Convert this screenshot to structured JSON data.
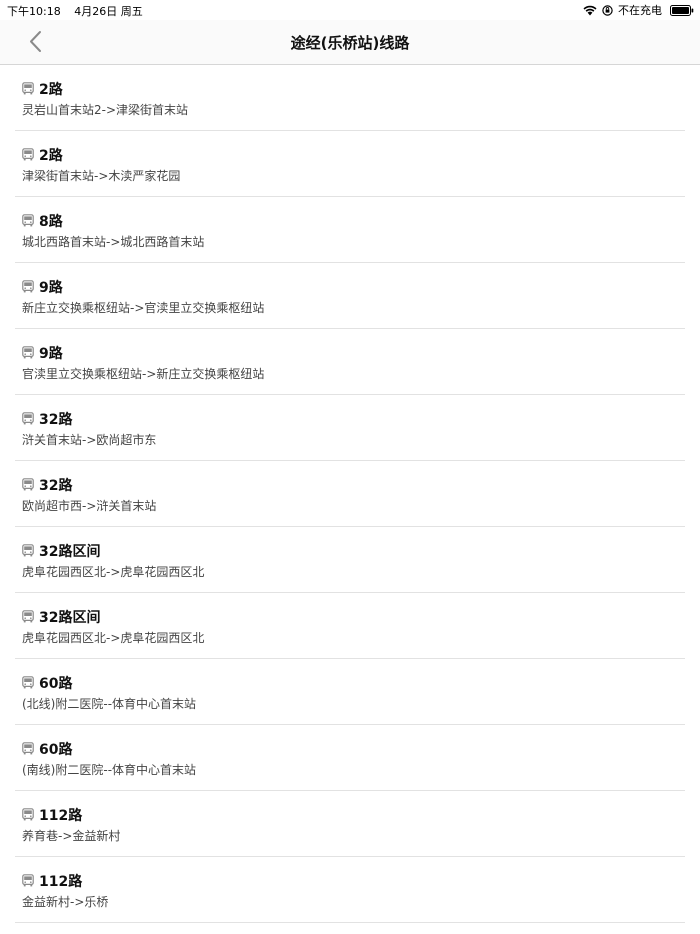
{
  "status_bar": {
    "time": "下午10:18",
    "date": "4月26日 周五",
    "charging": "不在充电",
    "icons": [
      "wifi-icon",
      "orientation-lock-icon",
      "battery-icon"
    ]
  },
  "nav": {
    "title": "途经(乐桥站)线路",
    "back_icon": "chevron-left-icon"
  },
  "routes": [
    {
      "name": "2路",
      "desc": "灵岩山首末站2->津梁街首末站"
    },
    {
      "name": "2路",
      "desc": "津梁街首末站->木渎严家花园"
    },
    {
      "name": "8路",
      "desc": "城北西路首末站->城北西路首末站"
    },
    {
      "name": "9路",
      "desc": "新庄立交换乘枢纽站->官渎里立交换乘枢纽站"
    },
    {
      "name": "9路",
      "desc": "官渎里立交换乘枢纽站->新庄立交换乘枢纽站"
    },
    {
      "name": "32路",
      "desc": "浒关首末站->欧尚超市东"
    },
    {
      "name": "32路",
      "desc": "欧尚超市西->浒关首末站"
    },
    {
      "name": "32路区间",
      "desc": "虎阜花园西区北->虎阜花园西区北"
    },
    {
      "name": "32路区间",
      "desc": "虎阜花园西区北->虎阜花园西区北"
    },
    {
      "name": "60路",
      "desc": "(北线)附二医院--体育中心首末站"
    },
    {
      "name": "60路",
      "desc": "(南线)附二医院--体育中心首末站"
    },
    {
      "name": "112路",
      "desc": "养育巷->金益新村"
    },
    {
      "name": "112路",
      "desc": "金益新村->乐桥"
    }
  ],
  "colors": {
    "divider": "#e2e2e2",
    "text_primary": "#111111",
    "text_secondary": "#444444",
    "icon_gray": "#8a8a8a"
  }
}
